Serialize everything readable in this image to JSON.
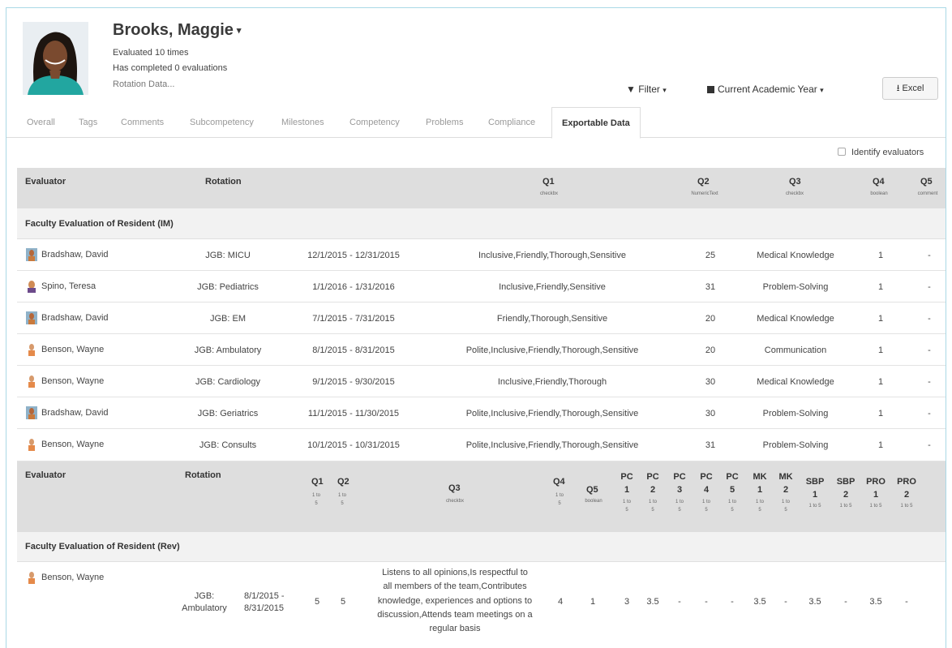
{
  "profile": {
    "name": "Brooks, Maggie",
    "evaluated": "Evaluated 10 times",
    "completed": "Has completed 0 evaluations",
    "rotation_data": "Rotation Data..."
  },
  "toolbar": {
    "filter_label": "Filter",
    "year_label": "Current Academic Year",
    "excel_label": "Excel"
  },
  "tabs": [
    "Overall",
    "Tags",
    "Comments",
    "Subcompetency",
    "Milestones",
    "Competency",
    "Problems",
    "Compliance",
    "Exportable Data"
  ],
  "active_tab": "Exportable Data",
  "identify_label": "Identify evaluators",
  "table1": {
    "headers": {
      "evaluator": "Evaluator",
      "rotation": "Rotation",
      "q1": "Q1",
      "q1_sub": "checkbx",
      "q2": "Q2",
      "q2_sub": "NumericText",
      "q3": "Q3",
      "q3_sub": "checkbx",
      "q4": "Q4",
      "q4_sub": "boolean",
      "q5": "Q5",
      "q5_sub": "comment"
    },
    "group": "Faculty Evaluation of Resident (IM)",
    "rows": [
      {
        "evaluator": "Bradshaw, David",
        "rotation": "JGB: MICU",
        "dates": "12/1/2015 - 12/31/2015",
        "q1": "Inclusive,Friendly,Thorough,Sensitive",
        "q2": "25",
        "q3": "Medical Knowledge",
        "q4": "1",
        "q5": "-"
      },
      {
        "evaluator": "Spino, Teresa",
        "rotation": "JGB: Pediatrics",
        "dates": "1/1/2016 - 1/31/2016",
        "q1": "Inclusive,Friendly,Sensitive",
        "q2": "31",
        "q3": "Problem-Solving",
        "q4": "1",
        "q5": "-"
      },
      {
        "evaluator": "Bradshaw, David",
        "rotation": "JGB: EM",
        "dates": "7/1/2015 - 7/31/2015",
        "q1": "Friendly,Thorough,Sensitive",
        "q2": "20",
        "q3": "Medical Knowledge",
        "q4": "1",
        "q5": "-"
      },
      {
        "evaluator": "Benson, Wayne",
        "rotation": "JGB: Ambulatory",
        "dates": "8/1/2015 - 8/31/2015",
        "q1": "Polite,Inclusive,Friendly,Thorough,Sensitive",
        "q2": "20",
        "q3": "Communication",
        "q4": "1",
        "q5": "-"
      },
      {
        "evaluator": "Benson, Wayne",
        "rotation": "JGB: Cardiology",
        "dates": "9/1/2015 - 9/30/2015",
        "q1": "Inclusive,Friendly,Thorough",
        "q2": "30",
        "q3": "Medical Knowledge",
        "q4": "1",
        "q5": "-"
      },
      {
        "evaluator": "Bradshaw, David",
        "rotation": "JGB: Geriatrics",
        "dates": "11/1/2015 - 11/30/2015",
        "q1": "Polite,Inclusive,Friendly,Thorough,Sensitive",
        "q2": "30",
        "q3": "Problem-Solving",
        "q4": "1",
        "q5": "-"
      },
      {
        "evaluator": "Benson, Wayne",
        "rotation": "JGB: Consults",
        "dates": "10/1/2015 - 10/31/2015",
        "q1": "Polite,Inclusive,Friendly,Thorough,Sensitive",
        "q2": "31",
        "q3": "Problem-Solving",
        "q4": "1",
        "q5": "-"
      }
    ]
  },
  "table2": {
    "headers": {
      "evaluator": "Evaluator",
      "rotation": "Rotation",
      "q1": "Q1",
      "q2": "Q2",
      "q3": "Q3",
      "q3_sub": "checkbx",
      "q4": "Q4",
      "q5": "Q5",
      "q5_sub": "boolean",
      "scale": "1 to 5",
      "pc1": [
        "PC",
        "1"
      ],
      "pc2": [
        "PC",
        "2"
      ],
      "pc3": [
        "PC",
        "3"
      ],
      "pc4": [
        "PC",
        "4"
      ],
      "pc5": [
        "PC",
        "5"
      ],
      "mk1": [
        "MK",
        "1"
      ],
      "mk2": [
        "MK",
        "2"
      ],
      "sbp1": [
        "SBP",
        "1"
      ],
      "sbp2": [
        "SBP",
        "2"
      ],
      "pro1": [
        "PRO",
        "1"
      ],
      "pro2": [
        "PRO",
        "2"
      ]
    },
    "group": "Faculty Evaluation of Resident (Rev)",
    "row": {
      "evaluator": "Benson, Wayne",
      "rotation_1": "JGB:",
      "rotation_2": "Ambulatory",
      "date_1": "8/1/2015 -",
      "date_2": "8/31/2015",
      "q1": "5",
      "q2": "5",
      "q3_lines": [
        "Listens to all opinions,Is respectful to",
        "all members of the team,Contributes",
        "knowledge, experiences and options to",
        "discussion,Attends team meetings on a",
        "regular basis"
      ],
      "q4": "4",
      "q5": "1",
      "pc1": "3",
      "pc2": "3.5",
      "pc3": "-",
      "pc4": "-",
      "pc5": "-",
      "mk1": "3.5",
      "mk2": "-",
      "sbp1": "3.5",
      "sbp2": "-",
      "pro1": "3.5",
      "pro2": "-"
    }
  },
  "colors": {
    "frame_border": "#a9d9e6",
    "header_bg": "#dedede",
    "group_bg": "#f2f2f2"
  }
}
